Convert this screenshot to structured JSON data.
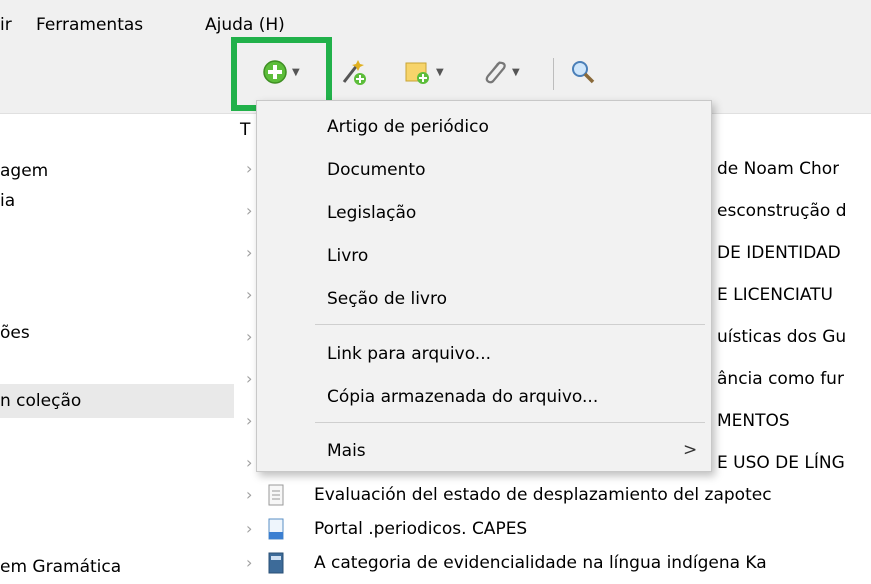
{
  "menubar": {
    "items": [
      "ir",
      "Ferramentas",
      "Ajuda (H)"
    ]
  },
  "toolbar": {
    "icons": [
      "new-item-icon",
      "magic-wand-add-icon",
      "new-note-icon",
      "attachment-icon",
      "search-icon"
    ],
    "accent": "#21b14a"
  },
  "left_pane": {
    "items": [
      "agem",
      "ia",
      "ões",
      "n coleção",
      "em Gramática"
    ],
    "selected_index": 3
  },
  "items_list": {
    "column_header": "T",
    "rows": [
      "de Noam Chor",
      "esconstrução d",
      "DE IDENTIDAD",
      "E LICENCIATU",
      "uísticas dos Gu",
      "ância como fur",
      "MENTOS",
      "E USO DE LÍNG",
      "Evaluación del estado de desplazamiento del zapotec",
      "Portal .periodicos. CAPES",
      "A categoria de evidencialidade na língua indígena Ka"
    ]
  },
  "dropdown": {
    "items": [
      "Artigo de periódico",
      "Documento",
      "Legislação",
      "Livro",
      "Seção de livro",
      "Link para arquivo...",
      "Cópia armazenada do arquivo...",
      "Mais"
    ],
    "submenu_arrow": ">"
  }
}
